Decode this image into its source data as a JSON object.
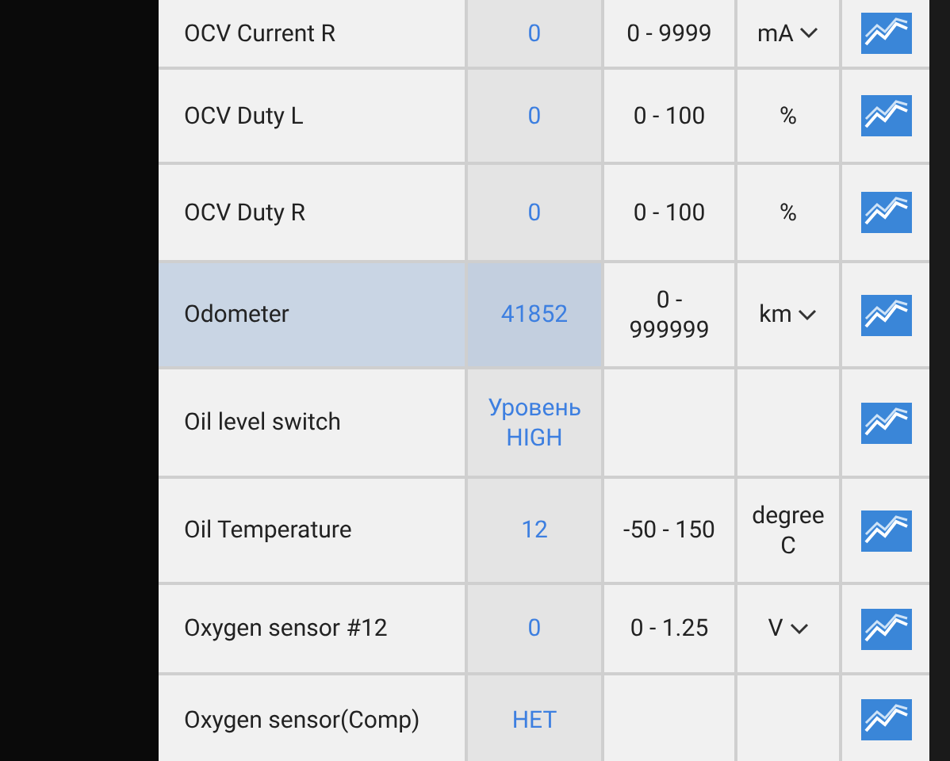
{
  "rows": [
    {
      "name": "OCV Current R",
      "value": "0",
      "range": "0 - 9999",
      "unit": "mA",
      "dropdown": true,
      "selected": false
    },
    {
      "name": "OCV Duty L",
      "value": "0",
      "range": "0 - 100",
      "unit": "%",
      "dropdown": false,
      "selected": false
    },
    {
      "name": "OCV Duty R",
      "value": "0",
      "range": "0 - 100",
      "unit": "%",
      "dropdown": false,
      "selected": false
    },
    {
      "name": "Odometer",
      "value": "41852",
      "range": "0 - 999999",
      "unit": "km",
      "dropdown": true,
      "selected": true
    },
    {
      "name": "Oil level switch",
      "value": "Уровень HIGH",
      "unit": "",
      "dropdown": false,
      "selected": false
    },
    {
      "name": "Oil Temperature",
      "value": "12",
      "range": "-50 - 150",
      "unit": "degree C",
      "dropdown": false,
      "selected": false
    },
    {
      "name": "Oxygen sensor #12",
      "value": "0",
      "range": "0 - 1.25",
      "unit": "V",
      "dropdown": true,
      "selected": false
    },
    {
      "name": "Oxygen sensor(Comp)",
      "value": "НЕТ",
      "dropdown": false,
      "selected": false
    }
  ]
}
